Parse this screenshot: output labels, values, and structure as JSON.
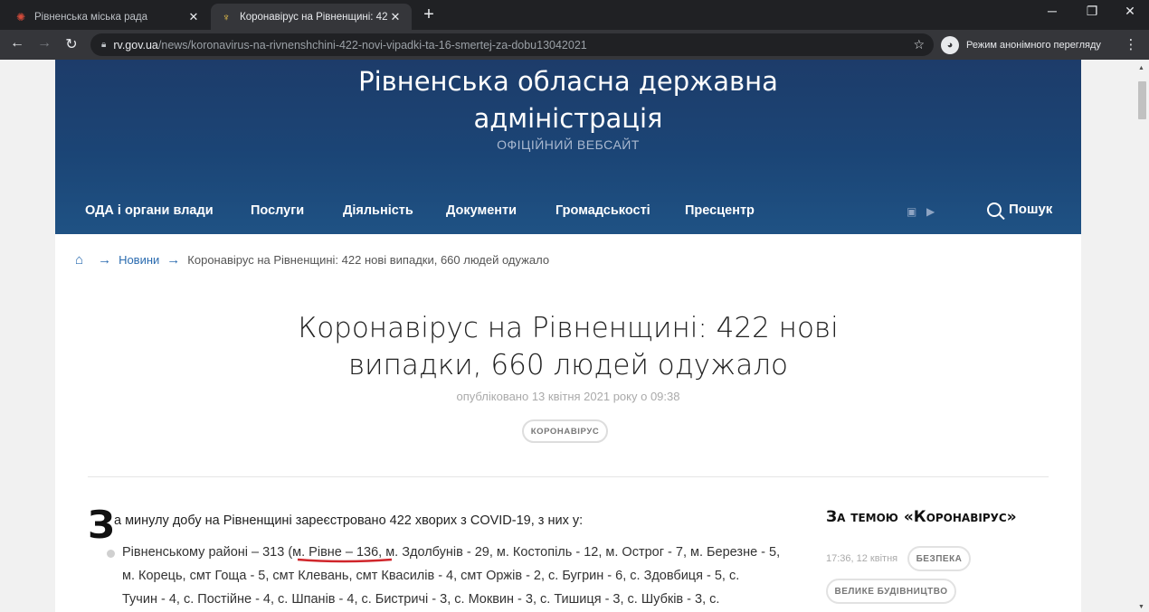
{
  "browser": {
    "tabs": [
      {
        "title": "Рівненська міська рада",
        "active": false
      },
      {
        "title": "Коронавірус на Рівненщині: 422",
        "active": true
      }
    ],
    "url_host": "rv.gov.ua",
    "url_path": "/news/koronavirus-na-rivnenshchini-422-novi-vipadki-ta-16-smertej-za-dobu13042021",
    "incognito_label": "Режим анонімного перегляду"
  },
  "header": {
    "title_line1": "Рівненська обласна державна",
    "title_line2": "адміністрація",
    "subtitle": "ОФІЦІЙНИЙ ВЕБСАЙТ"
  },
  "nav": {
    "items": [
      "ОДА і органи влади",
      "Послуги",
      "Діяльність",
      "Документи",
      "Громадськості",
      "Пресцентр"
    ],
    "search_label": "Пошук"
  },
  "breadcrumb": {
    "news": "Новини",
    "current": "Коронавірус на Рівненщині: 422 нові випадки, 660 людей одужало"
  },
  "article": {
    "title_line1": "Коронавірус на Рівненщині: 422 нові",
    "title_line2": "випадки, 660 людей одужало",
    "published": "опубліковано 13 квітня 2021 року о 09:38",
    "tag": "КОРОНАВІРУС",
    "dropcap": "З",
    "lead": "а минулу добу на Рівненщині зареєстровано 422 хворих з COVID-19, з них у:",
    "bullet_lines": [
      "Рівненському районі – 313 (м. Рівне – 136, м. Здолбунів - 29, м. Костопіль - 12, м. Острог - 7, м. Березне - 5,",
      "м. Корець, смт Гоща - 5, смт Клевань, смт Квасилів - 4, смт Оржів - 2, с. Бугрин - 6, с. Здовбиця - 5, с.",
      "Тучин - 4, с. Постійне - 4, с. Шпанів - 4, с. Бистричі - 3, с. Моквин - 3, с. Тишиця - 3, с. Шубків - 3, с."
    ]
  },
  "sidebar": {
    "title": "За темою «Коронавірус»",
    "time": "17:36, 12 квітня",
    "tags": [
      "БЕЗПЕКА",
      "ВЕЛИКЕ БУДІВНИЦТВО"
    ]
  },
  "colors": {
    "header_bg": "#1b4576",
    "link": "#2b6cb0",
    "underline_mark": "#d0262b"
  }
}
